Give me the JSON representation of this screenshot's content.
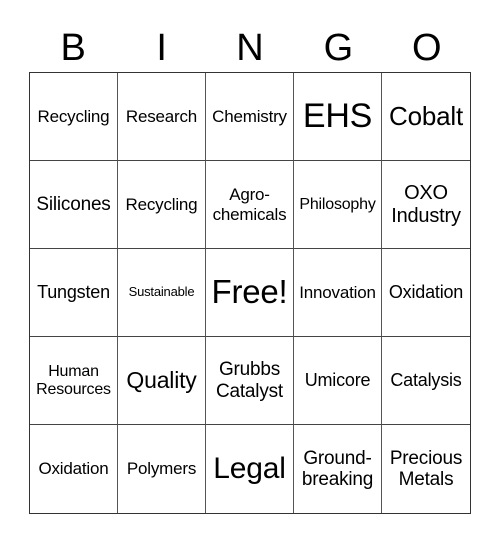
{
  "header": [
    "B",
    "I",
    "N",
    "G",
    "O"
  ],
  "cells": [
    "Recycling",
    "Research",
    "Chemistry",
    "EHS",
    "Cobalt",
    "Silicones",
    "Recycling",
    "Agro-\nchemicals",
    "Philosophy",
    "OXO\nIndustry",
    "Tungsten",
    "Sustainable",
    "Free!",
    "Innovation",
    "Oxidation",
    "Human\nResources",
    "Quality",
    "Grubbs\nCatalyst",
    "Umicore",
    "Catalysis",
    "Oxidation",
    "Polymers",
    "Legal",
    "Ground-\nbreaking",
    "Precious\nMetals"
  ]
}
